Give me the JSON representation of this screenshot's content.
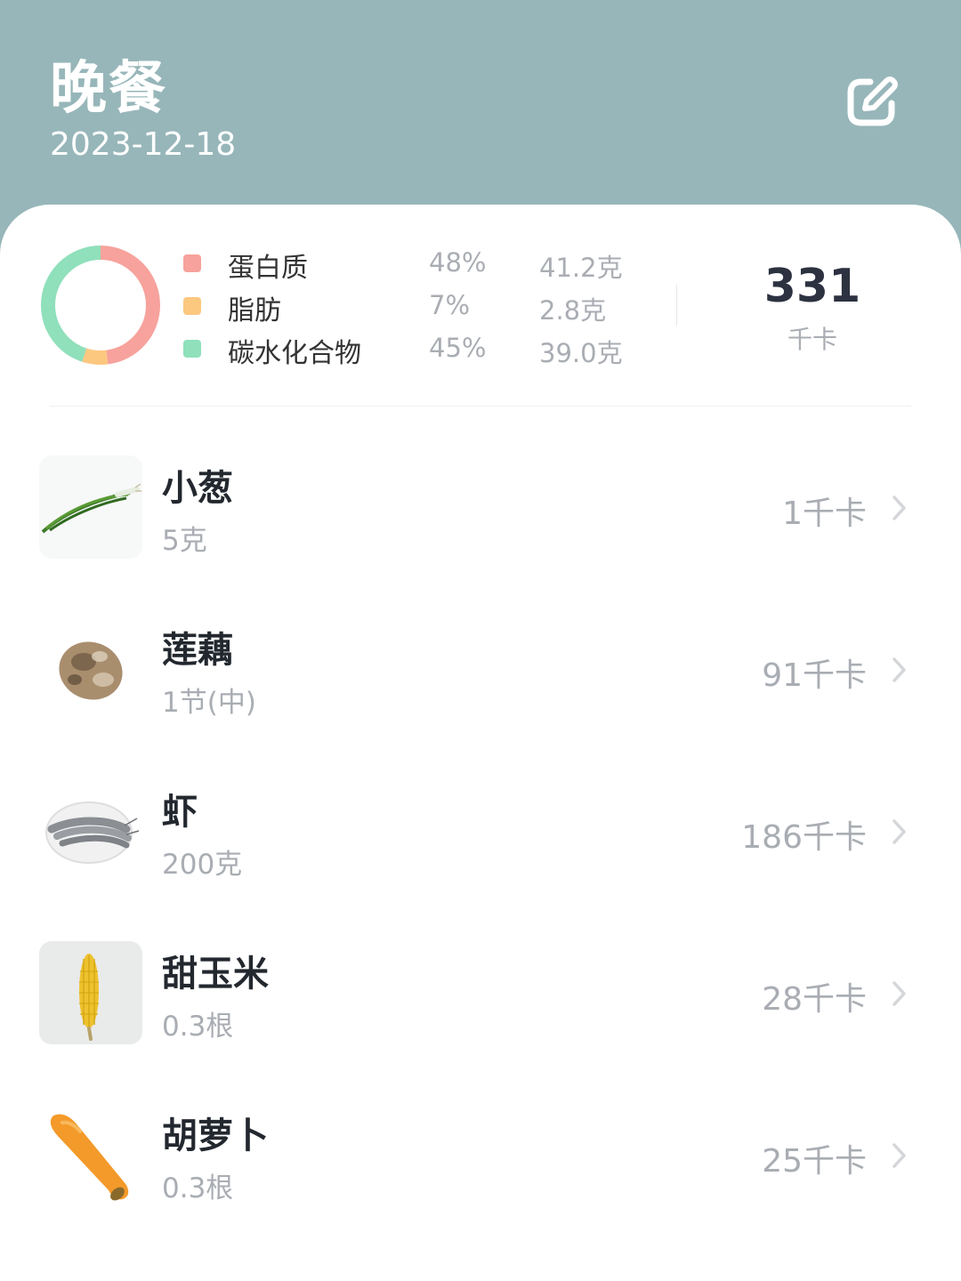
{
  "header": {
    "title": "晚餐",
    "date": "2023-12-18",
    "edit_icon": "edit-square-icon",
    "background_color": "#97b6b9"
  },
  "summary": {
    "macros": [
      {
        "name": "蛋白质",
        "percent": "48%",
        "grams": "41.2克",
        "color": "#f7a29c"
      },
      {
        "name": "脂肪",
        "percent": "7%",
        "grams": "2.8克",
        "color": "#fcc880"
      },
      {
        "name": "碳水化合物",
        "percent": "45%",
        "grams": "39.0克",
        "color": "#8fe0bb"
      }
    ],
    "total_kcal": "331",
    "total_unit": "千卡"
  },
  "chart_data": {
    "type": "pie",
    "categories": [
      "蛋白质",
      "脂肪",
      "碳水化合物"
    ],
    "values": [
      48,
      7,
      45
    ],
    "colors": [
      "#f7a29c",
      "#fcc880",
      "#8fe0bb"
    ]
  },
  "foods": [
    {
      "name": "小葱",
      "amount": "5克",
      "kcal": "1千卡",
      "image": "scallion"
    },
    {
      "name": "莲藕",
      "amount": "1节(中)",
      "kcal": "91千卡",
      "image": "lotus-root"
    },
    {
      "name": "虾",
      "amount": "200克",
      "kcal": "186千卡",
      "image": "shrimp"
    },
    {
      "name": "甜玉米",
      "amount": "0.3根",
      "kcal": "28千卡",
      "image": "sweet-corn"
    },
    {
      "name": "胡萝卜",
      "amount": "0.3根",
      "kcal": "25千卡",
      "image": "carrot"
    }
  ]
}
